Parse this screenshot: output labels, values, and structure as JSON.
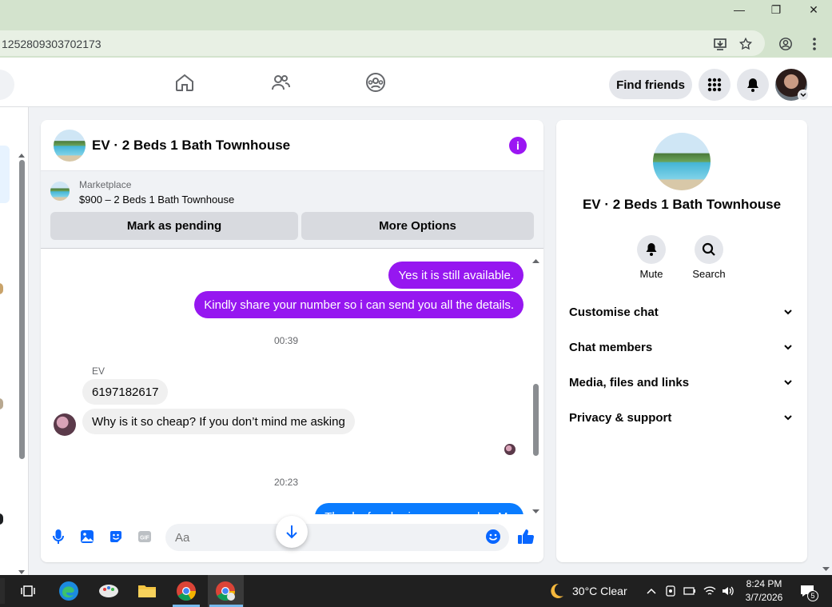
{
  "browser": {
    "url": "1252809303702173",
    "window_controls": {
      "minimize": "—",
      "restore": "❐",
      "close": "✕"
    }
  },
  "navbar": {
    "find_friends_label": "Find friends"
  },
  "chat": {
    "title": "EV · 2 Beds 1 Bath Townhouse",
    "marketplace_label": "Marketplace",
    "marketplace_item": "$900 – 2 Beds 1 Bath Townhouse",
    "mark_pending_label": "Mark as pending",
    "more_options_label": "More Options",
    "messages": {
      "out_1": "Yes it is still available.",
      "out_2": "Kindly share your number so i can send you all the details.",
      "time_1": "00:39",
      "sender": "EV",
      "in_1": "6197182617",
      "in_2": "Why is it so cheap? If you don’t mind me asking",
      "time_2": "20:23",
      "out_3_partial": "Thanks for sharing your number My"
    },
    "composer_placeholder": "Aa"
  },
  "info_panel": {
    "title": "EV · 2 Beds 1 Bath Townhouse",
    "mute_label": "Mute",
    "search_label": "Search",
    "sections": [
      "Customise chat",
      "Chat members",
      "Media, files and links",
      "Privacy & support"
    ]
  },
  "taskbar": {
    "weather": "30°C  Clear",
    "time": "8:24 PM",
    "date": "3/7/2026",
    "notification_count": "5"
  },
  "colors": {
    "purple_bubble": "#9617f0",
    "blue_bubble": "#0a7cff",
    "accent_purple": "#9b16f3",
    "chrome_green": "#d3e3cd"
  }
}
